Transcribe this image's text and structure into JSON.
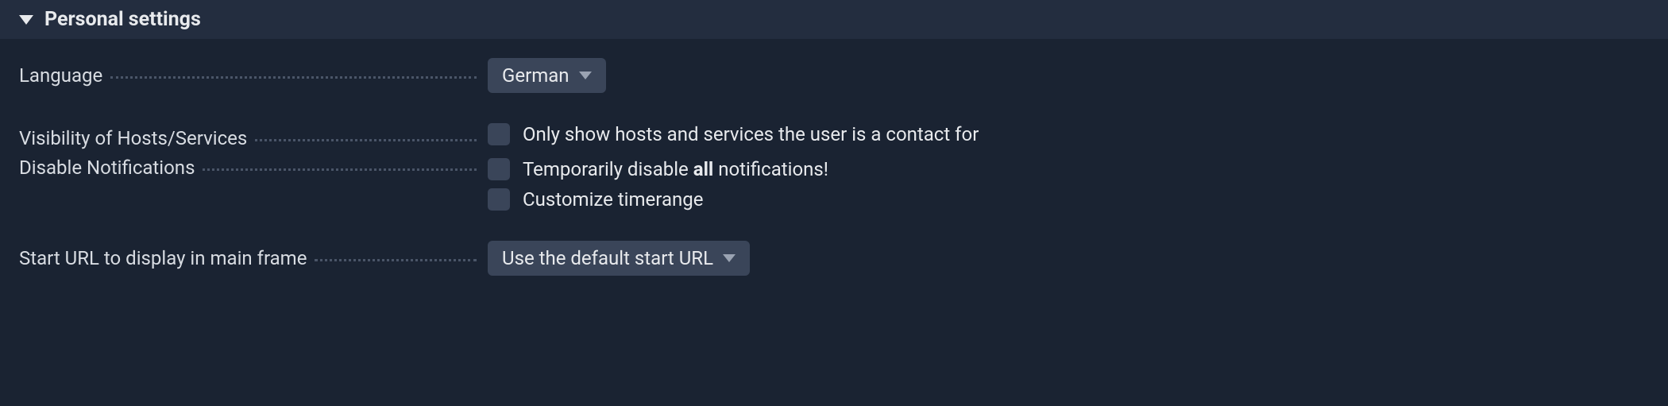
{
  "section": {
    "title": "Personal settings"
  },
  "settings": {
    "language": {
      "label": "Language",
      "value": "German"
    },
    "visibility": {
      "label": "Visibility of Hosts/Services",
      "checkbox_label": "Only show hosts and services the user is a contact for"
    },
    "notifications": {
      "label": "Disable Notifications",
      "disable_prefix": "Temporarily disable ",
      "disable_bold": "all",
      "disable_suffix": " notifications!",
      "timerange_label": "Customize timerange"
    },
    "start_url": {
      "label": "Start URL to display in main frame",
      "value": "Use the default start URL"
    }
  }
}
